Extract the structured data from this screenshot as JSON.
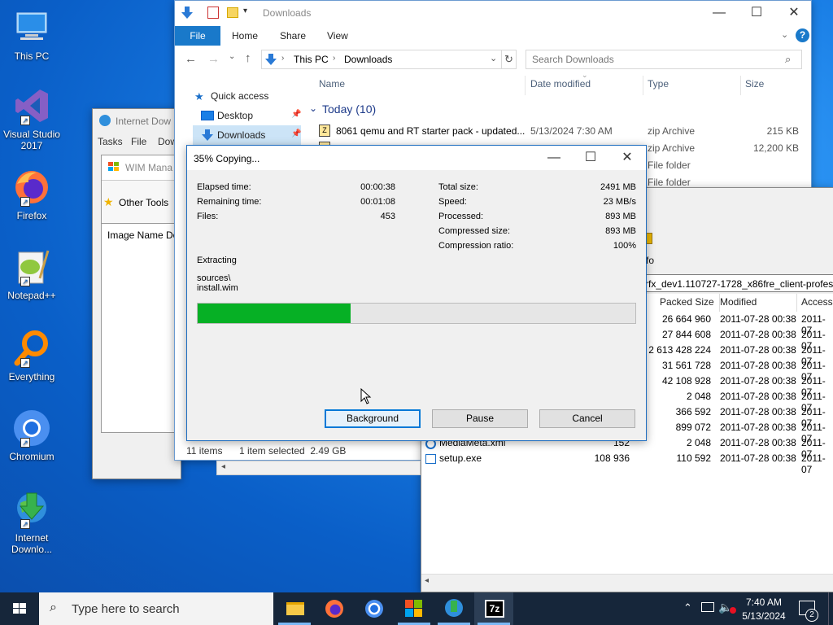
{
  "desktop": {
    "icons": [
      {
        "label": "This PC"
      },
      {
        "label": "Visual Studio 2017"
      },
      {
        "label": "Firefox"
      },
      {
        "label": "Notepad++"
      },
      {
        "label": "Everything"
      },
      {
        "label": "Chromium"
      },
      {
        "label": "Internet Downlo..."
      }
    ]
  },
  "explorer": {
    "title": "Downloads",
    "ribbon_tabs": [
      "File",
      "Home",
      "Share",
      "View"
    ],
    "breadcrumb": [
      "This PC",
      "Downloads"
    ],
    "search_placeholder": "Search Downloads",
    "columns": [
      "Name",
      "Date modified",
      "Type",
      "Size"
    ],
    "nav": [
      "Quick access",
      "Desktop",
      "Downloads"
    ],
    "group": "Today (10)",
    "files": [
      {
        "name": "8061 qemu and RT starter pack - updated...",
        "date": "5/13/2024 7:30 AM",
        "type": "zip Archive",
        "size": "215 KB"
      },
      {
        "name": "",
        "date": "",
        "type": "zip Archive",
        "size": "12,200 KB"
      },
      {
        "name": "",
        "date": "",
        "type": "File folder",
        "size": ""
      },
      {
        "name": "",
        "date": "",
        "type": "File folder",
        "size": ""
      }
    ],
    "status_items": "11 items",
    "status_selected": "1 item selected  2.49 GB"
  },
  "idm": {
    "title": "Internet Dow",
    "menu": [
      "Tasks",
      "File",
      "Dow"
    ],
    "wim_title": "WIM Mana",
    "other_tools": "Other Tools",
    "col_image_name": "Image Name",
    "col_de": "De"
  },
  "sevenzip": {
    "fo": "fo",
    "path": "rfx_dev1.110727-1728_x86fre_client-professi",
    "columns": [
      "Packed Size",
      "Modified",
      "Accesse"
    ],
    "rows": [
      {
        "name": "",
        "size": "",
        "packed": "26 664 960",
        "modified": "2011-07-28 00:38",
        "accessed": "2011-07"
      },
      {
        "name": "",
        "size": "",
        "packed": "27 844 608",
        "modified": "2011-07-28 00:38",
        "accessed": "2011-07"
      },
      {
        "name": "",
        "size": "",
        "packed": "2 613 428 224",
        "modified": "2011-07-28 00:38",
        "accessed": "2011-07"
      },
      {
        "name": "",
        "size": "",
        "packed": "31 561 728",
        "modified": "2011-07-28 00:38",
        "accessed": "2011-07"
      },
      {
        "name": "",
        "size": "",
        "packed": "42 108 928",
        "modified": "2011-07-28 00:38",
        "accessed": "2011-07"
      },
      {
        "name": "",
        "size": "",
        "packed": "2 048",
        "modified": "2011-07-28 00:38",
        "accessed": "2011-07"
      },
      {
        "name": "",
        "size": "",
        "packed": "366 592",
        "modified": "2011-07-28 00:38",
        "accessed": "2011-07"
      },
      {
        "name": "",
        "size": "",
        "packed": "899 072",
        "modified": "2011-07-28 00:38",
        "accessed": "2011-07"
      },
      {
        "name": "MediaMeta.xml",
        "size": "152",
        "packed": "2 048",
        "modified": "2011-07-28 00:38",
        "accessed": "2011-07"
      },
      {
        "name": "setup.exe",
        "size": "108 936",
        "packed": "110 592",
        "modified": "2011-07-28 00:38",
        "accessed": "2011-07"
      }
    ]
  },
  "copy_dialog": {
    "title": "35% Copying...",
    "progress_percent": 35,
    "left_stats": [
      {
        "label": "Elapsed time:",
        "value": "00:00:38"
      },
      {
        "label": "Remaining time:",
        "value": "00:01:08"
      },
      {
        "label": "Files:",
        "value": "453"
      }
    ],
    "right_stats": [
      {
        "label": "Total size:",
        "value": "2491 MB"
      },
      {
        "label": "Speed:",
        "value": "23 MB/s"
      },
      {
        "label": "Processed:",
        "value": "893 MB"
      },
      {
        "label": "Compressed size:",
        "value": "893 MB"
      },
      {
        "label": "Compression ratio:",
        "value": "100%"
      }
    ],
    "action": "Extracting",
    "file_line1": "sources\\",
    "file_line2": "install.wim",
    "buttons": {
      "background": "Background",
      "pause": "Pause",
      "cancel": "Cancel"
    }
  },
  "taskbar": {
    "search_placeholder": "Type here to search",
    "time": "7:40 AM",
    "date": "5/13/2024",
    "notification_count": "2",
    "sevenzip_label": "7z"
  }
}
